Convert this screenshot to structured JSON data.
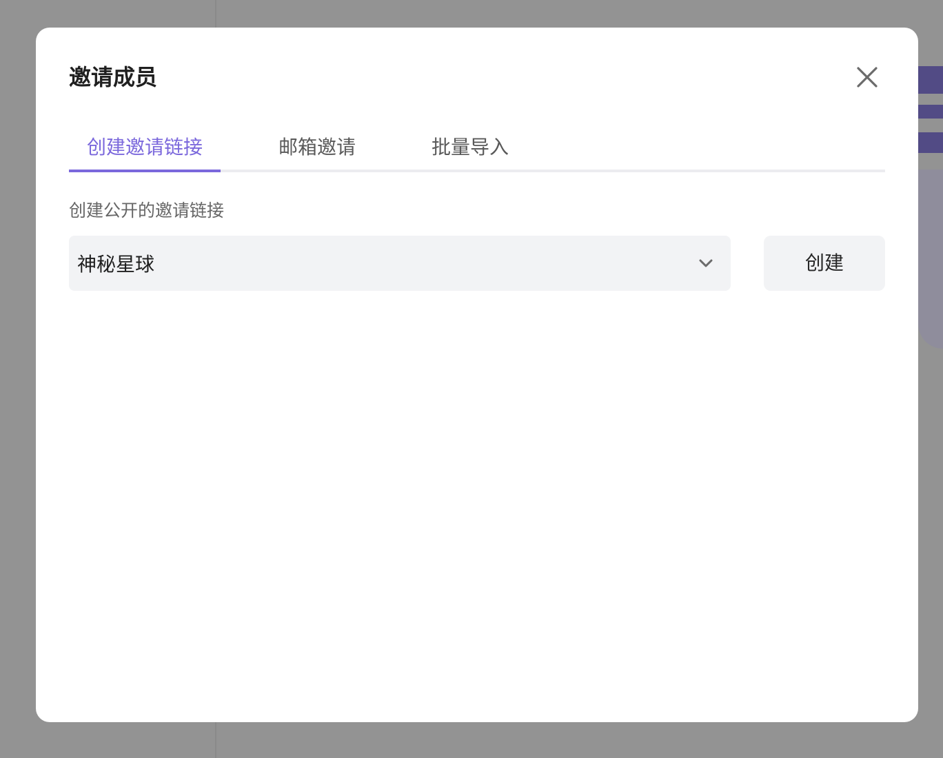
{
  "modal": {
    "title": "邀请成员",
    "close_icon": "close-icon"
  },
  "tabs": [
    {
      "label": "创建邀请链接",
      "active": true
    },
    {
      "label": "邮箱邀请",
      "active": false
    },
    {
      "label": "批量导入",
      "active": false
    }
  ],
  "invite_link": {
    "section_label": "创建公开的邀请链接",
    "select_value": "神秘星球",
    "chevron_icon": "chevron-down-icon",
    "create_button": "创建"
  },
  "colors": {
    "accent": "#7b68dc",
    "overlay": "#939393",
    "field_bg": "#f2f3f5"
  }
}
